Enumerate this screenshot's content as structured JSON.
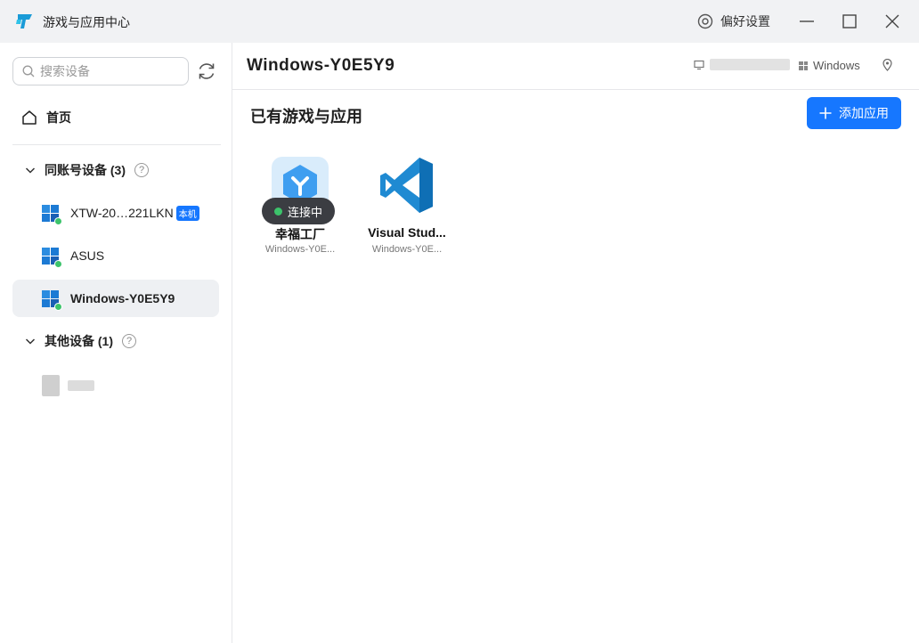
{
  "window": {
    "title": "游戏与应用中心",
    "preferences_label": "偏好设置"
  },
  "sidebar": {
    "search_placeholder": "搜索设备",
    "home_label": "首页",
    "groups": [
      {
        "label": "同账号设备 (3)"
      },
      {
        "label": "其他设备 (1)"
      }
    ],
    "devices": [
      {
        "name": "XTW-20…221LKN",
        "badge": "本机"
      },
      {
        "name": "ASUS"
      },
      {
        "name": "Windows-Y0E5Y9"
      }
    ]
  },
  "main": {
    "device_title": "Windows-Y0E5Y9",
    "os_label": "Windows",
    "section_title": "已有游戏与应用",
    "add_button_label": "添加应用",
    "apps": [
      {
        "name": "幸福工厂",
        "device": "Windows-Y0E...",
        "status": "连接中"
      },
      {
        "name": "Visual Stud...",
        "device": "Windows-Y0E..."
      }
    ]
  }
}
